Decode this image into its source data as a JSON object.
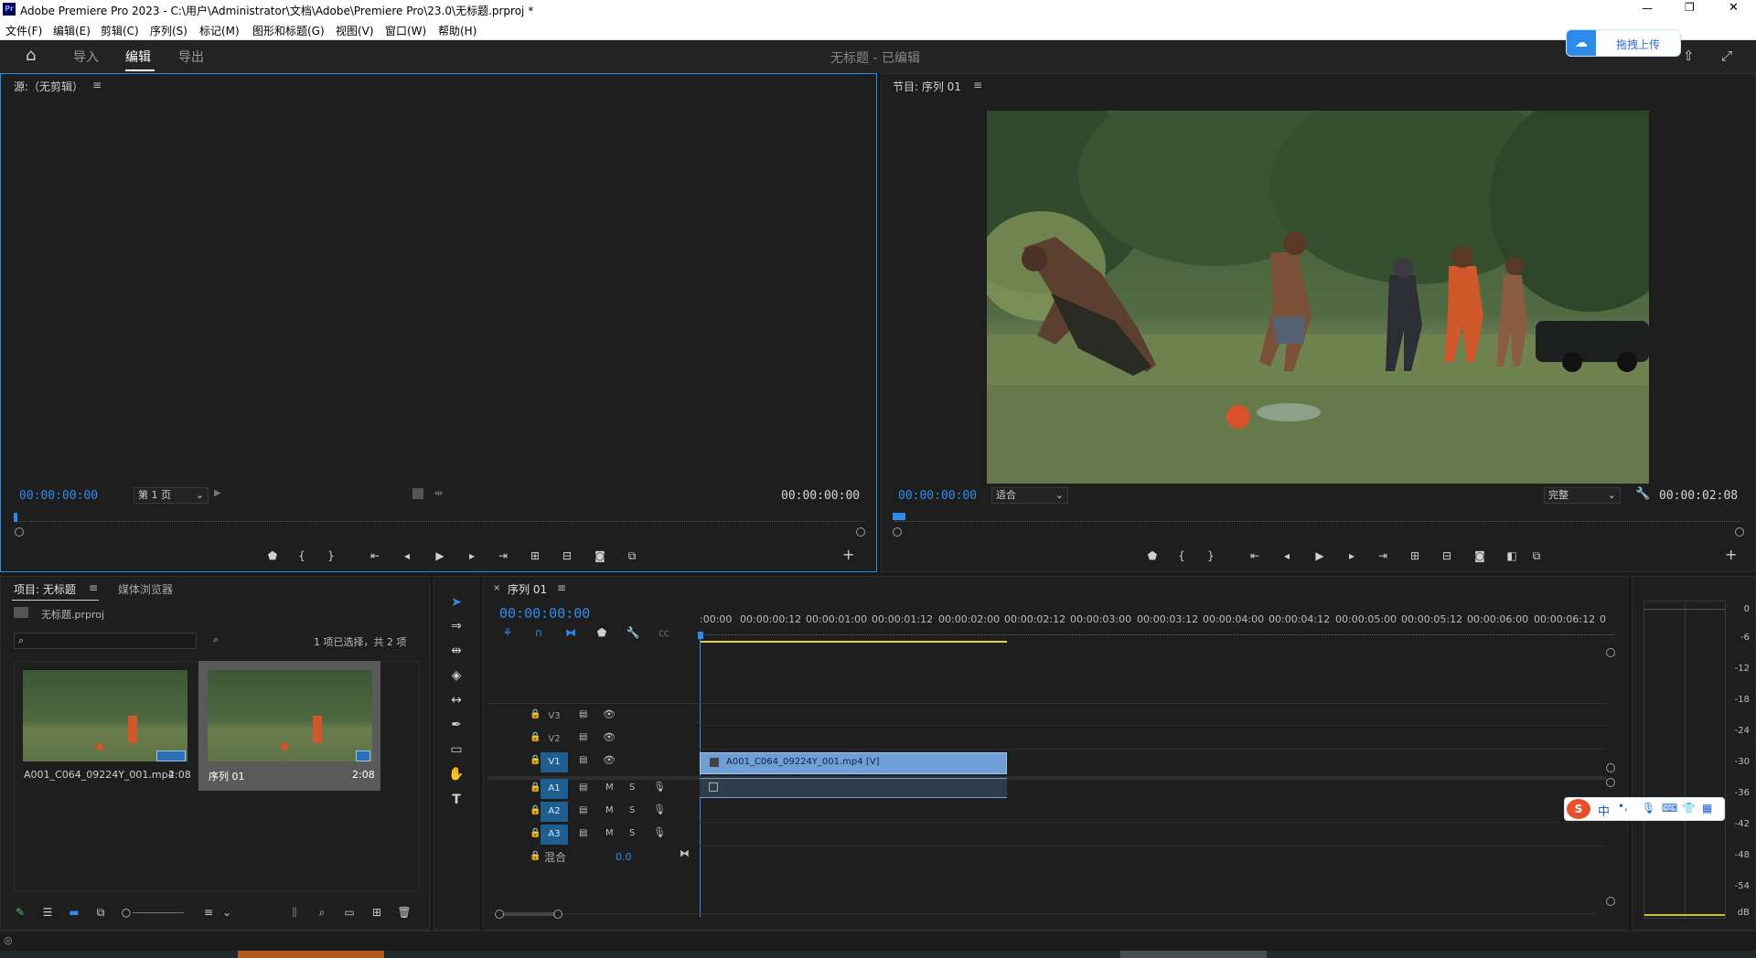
{
  "window": {
    "title": "Adobe Premiere Pro 2023 - C:\\用户\\Administrator\\文档\\Adobe\\Premiere Pro\\23.0\\无标题.prproj *",
    "app_icon": "Pr"
  },
  "menu": [
    "文件(F)",
    "编辑(E)",
    "剪辑(C)",
    "序列(S)",
    "标记(M)",
    "图形和标题(G)",
    "视图(V)",
    "窗口(W)",
    "帮助(H)"
  ],
  "workspace": {
    "tabs": [
      "导入",
      "编辑",
      "导出"
    ],
    "active_tab": "编辑",
    "doc_title": "无标题 - 已编辑",
    "upload_label": "拖拽上传"
  },
  "source_monitor": {
    "title": "源:（无剪辑）",
    "timecode_left": "00:00:00:00",
    "page_select": "第 1 页",
    "timecode_right": "00:00:00:00"
  },
  "program_monitor": {
    "title": "节目: 序列 01",
    "timecode_left": "00:00:00:00",
    "fit_select": "适合",
    "quality_select": "完整",
    "timecode_right": "00:00:02:08"
  },
  "project": {
    "tab_project": "项目: 无标题",
    "tab_media": "媒体浏览器",
    "file": "无标题.prproj",
    "selection_status": "1 项已选择，共 2 项",
    "items": [
      {
        "name": "A001_C064_09224Y_001.mp4",
        "duration": "2:08"
      },
      {
        "name": "序列 01",
        "duration": "2:08"
      }
    ]
  },
  "timeline": {
    "tab": "序列 01",
    "timecode": "00:00:00:00",
    "ruler": [
      ":00:00",
      "00:00:00:12",
      "00:00:01:00",
      "00:00:01:12",
      "00:00:02:00",
      "00:00:02:12",
      "00:00:03:00",
      "00:00:03:12",
      "00:00:04:00",
      "00:00:04:12",
      "00:00:05:00",
      "00:00:05:12",
      "00:00:06:00",
      "00:00:06:12",
      "0"
    ],
    "video_tracks": [
      "V3",
      "V2",
      "V1"
    ],
    "audio_tracks": [
      "A1",
      "A2",
      "A3"
    ],
    "mix_label": "混合",
    "mix_value": "0.0",
    "clip_name": "A001_C064_09224Y_001.mp4 [V]"
  },
  "meter": {
    "labels": [
      "0",
      "-6",
      "-12",
      "-18",
      "-24",
      "-30",
      "-36",
      "-42",
      "-48",
      "-54",
      "dB"
    ]
  },
  "ime": {
    "items": [
      "中",
      "•,"
    ]
  },
  "colors": {
    "accent": "#2d8ceb",
    "clip_video": "#6f9fd6",
    "panel_bg": "#1e1e1e"
  }
}
